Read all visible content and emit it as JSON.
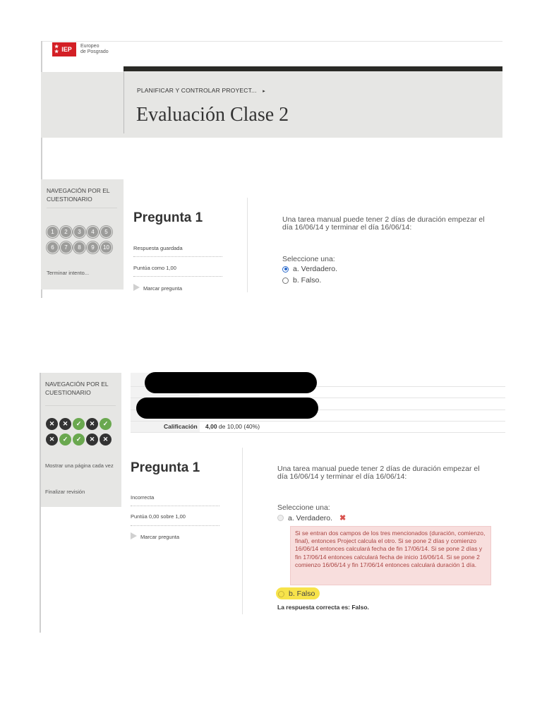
{
  "logo": {
    "abbr": "IEP",
    "line1": "Europeo",
    "line2": "de Posgrado"
  },
  "colors": {
    "brand_red": "#d31f25",
    "panel_gray": "#e6e6e4",
    "dark_bar": "#2a2a26",
    "correct_green": "#6aa84f",
    "wrong_dark": "#333333",
    "feedback_bg": "#f8dedd",
    "highlight": "#f7e34b",
    "radio_blue": "#2a6acc"
  },
  "header": {
    "breadcrumb": "PLANIFICAR Y CONTROLAR PROYECT...",
    "breadcrumb_arrow": "▸",
    "title": "Evaluación Clase 2"
  },
  "attempt": {
    "nav": {
      "title_line1": "NAVEGACIÓN POR EL",
      "title_line2": "CUESTIONARIO",
      "buttons": [
        "1",
        "2",
        "3",
        "4",
        "5",
        "6",
        "7",
        "8",
        "9",
        "10"
      ],
      "finish_link": "Terminar intento..."
    },
    "question": {
      "heading": "Pregunta 1",
      "status": "Respuesta guardada",
      "points": "Puntúa como 1,00",
      "flag_label": "Marcar pregunta",
      "text_line1": "Una tarea manual puede tener 2 días de duración empezar el",
      "text_line2": "día 16/06/14 y terminar el día 16/06/14:",
      "prompt": "Seleccione una:",
      "options": [
        "a. Verdadero.",
        "b. Falso."
      ],
      "selected": "a"
    }
  },
  "review": {
    "nav": {
      "title_line1": "NAVEGACIÓN POR EL",
      "title_line2": "CUESTIONARIO",
      "buttons_state": [
        "wrong",
        "wrong",
        "right",
        "wrong",
        "right",
        "wrong",
        "right",
        "right",
        "wrong",
        "wrong"
      ],
      "show_one_page": "Mostrar una página cada vez",
      "finish_review": "Finalizar revisión"
    },
    "summary": {
      "grade_label": "Calificación",
      "grade_value": "4,00",
      "grade_suffix": "de 10,00 (40%)"
    },
    "question": {
      "heading": "Pregunta 1",
      "status": "Incorrecta",
      "points": "Puntúa 0,00 sobre 1,00",
      "flag_label": "Marcar pregunta",
      "text_line1": "Una tarea manual puede tener 2 días de duración empezar el",
      "text_line2": "día 16/06/14 y terminar el día 16/06/14:",
      "prompt": "Seleccione una:",
      "option_a": "a. Verdadero.",
      "wrong_icon": "✖",
      "feedback": "Si se entran dos campos de los tres mencionados (duración, comienzo, final), entonces Project calcula el otro. Si se pone 2 días y comienzo 16/06/14 entonces calculará fecha de fin 17/06/14. Si se pone 2 días y fin 17/06/14 entonces calculará fecha de inicio 16/06/14. Si se pone 2 comienzo 16/06/14 y fin 17/06/14 entonces calculará duración 1 día.",
      "option_b": "b. Falso",
      "correct_answer": "La respuesta correcta es: Falso."
    }
  }
}
